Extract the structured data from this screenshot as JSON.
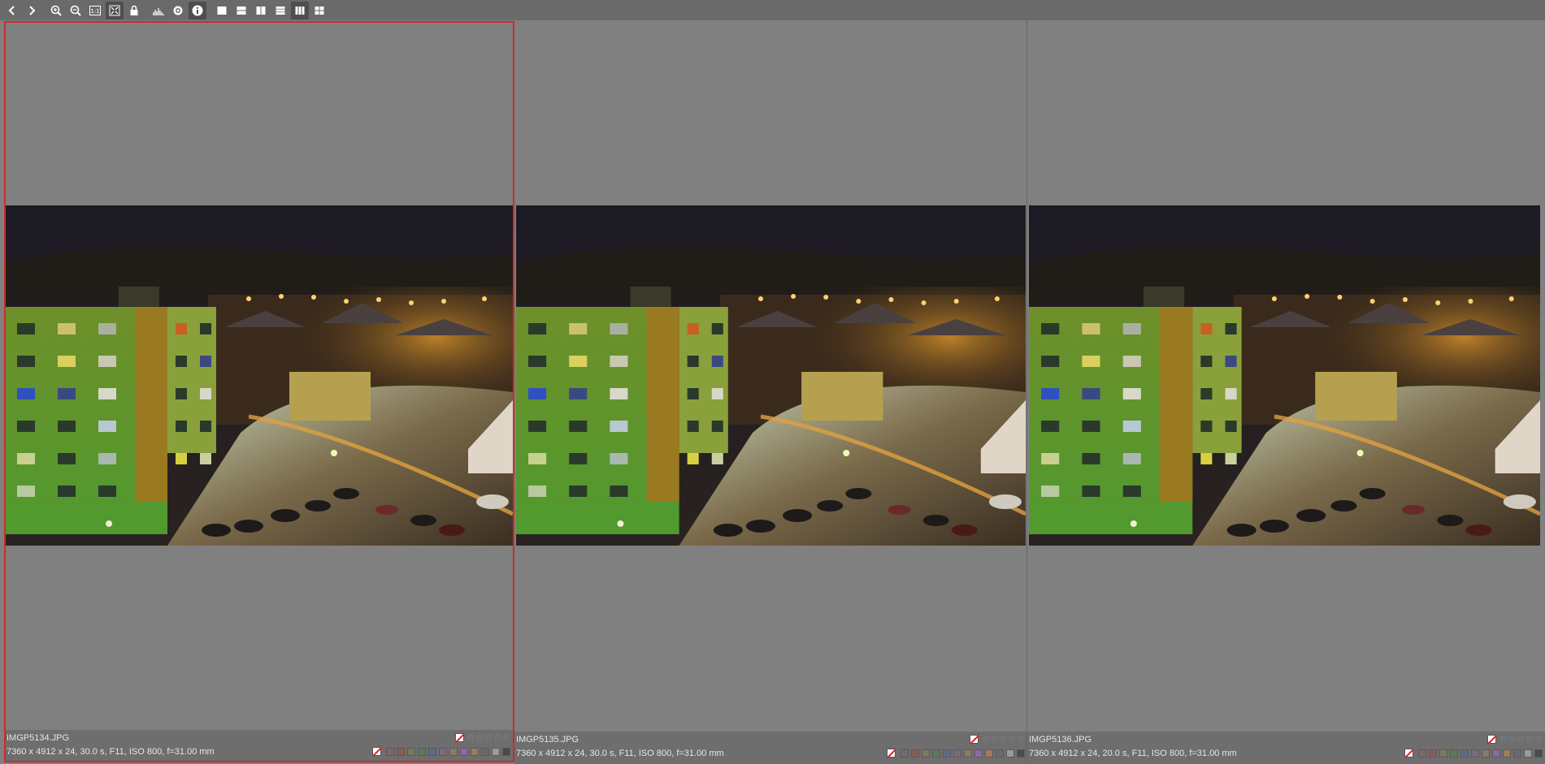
{
  "toolbar": {
    "buttons": [
      {
        "icon": "previous-arrow-icon"
      },
      {
        "icon": "next-arrow-icon"
      },
      {
        "icon": "zoom-in-icon"
      },
      {
        "icon": "zoom-out-icon"
      },
      {
        "icon": "actual-size-icon",
        "text": "1:1"
      },
      {
        "icon": "fit-to-window-icon",
        "active": true
      },
      {
        "icon": "lock-icon"
      },
      {
        "icon": "histogram-icon"
      },
      {
        "icon": "focus-peak-icon"
      },
      {
        "icon": "info-icon",
        "active": true
      },
      {
        "icon": "layout-single-icon"
      },
      {
        "icon": "layout-two-rows-icon"
      },
      {
        "icon": "layout-two-columns-icon"
      },
      {
        "icon": "layout-three-rows-icon"
      },
      {
        "icon": "layout-three-columns-icon",
        "active": true
      },
      {
        "icon": "layout-grid-icon"
      }
    ]
  },
  "colors": {
    "selection_border": "#cc2a2a",
    "label_swatches": [
      "#7a6a6a",
      "#8a5a5a",
      "#7a7a5a",
      "#5a7a5a",
      "#5a6a8a",
      "#7a6a7a",
      "#8a7a6a",
      "#8a6aa0",
      "#a07a5a",
      "#6a6a6a",
      "#9a9a9a",
      "#4a4a4a"
    ]
  },
  "panels": [
    {
      "filename": "IMGP5134.JPG",
      "meta": "7360 x 4912 x 24, 30.0 s, F11, ISO 800, f=31.00 mm",
      "selected": true,
      "stars": "☆☆☆☆☆"
    },
    {
      "filename": "IMGP5135.JPG",
      "meta": "7360 x 4912 x 24, 30.0 s, F11, ISO 800, f=31.00 mm",
      "selected": false,
      "stars": "☆☆☆☆☆"
    },
    {
      "filename": "IMGP5136.JPG",
      "meta": "7360 x 4912 x 24, 20.0 s, F11, ISO 800, f=31.00 mm",
      "selected": false,
      "stars": "☆☆☆☆☆"
    }
  ]
}
